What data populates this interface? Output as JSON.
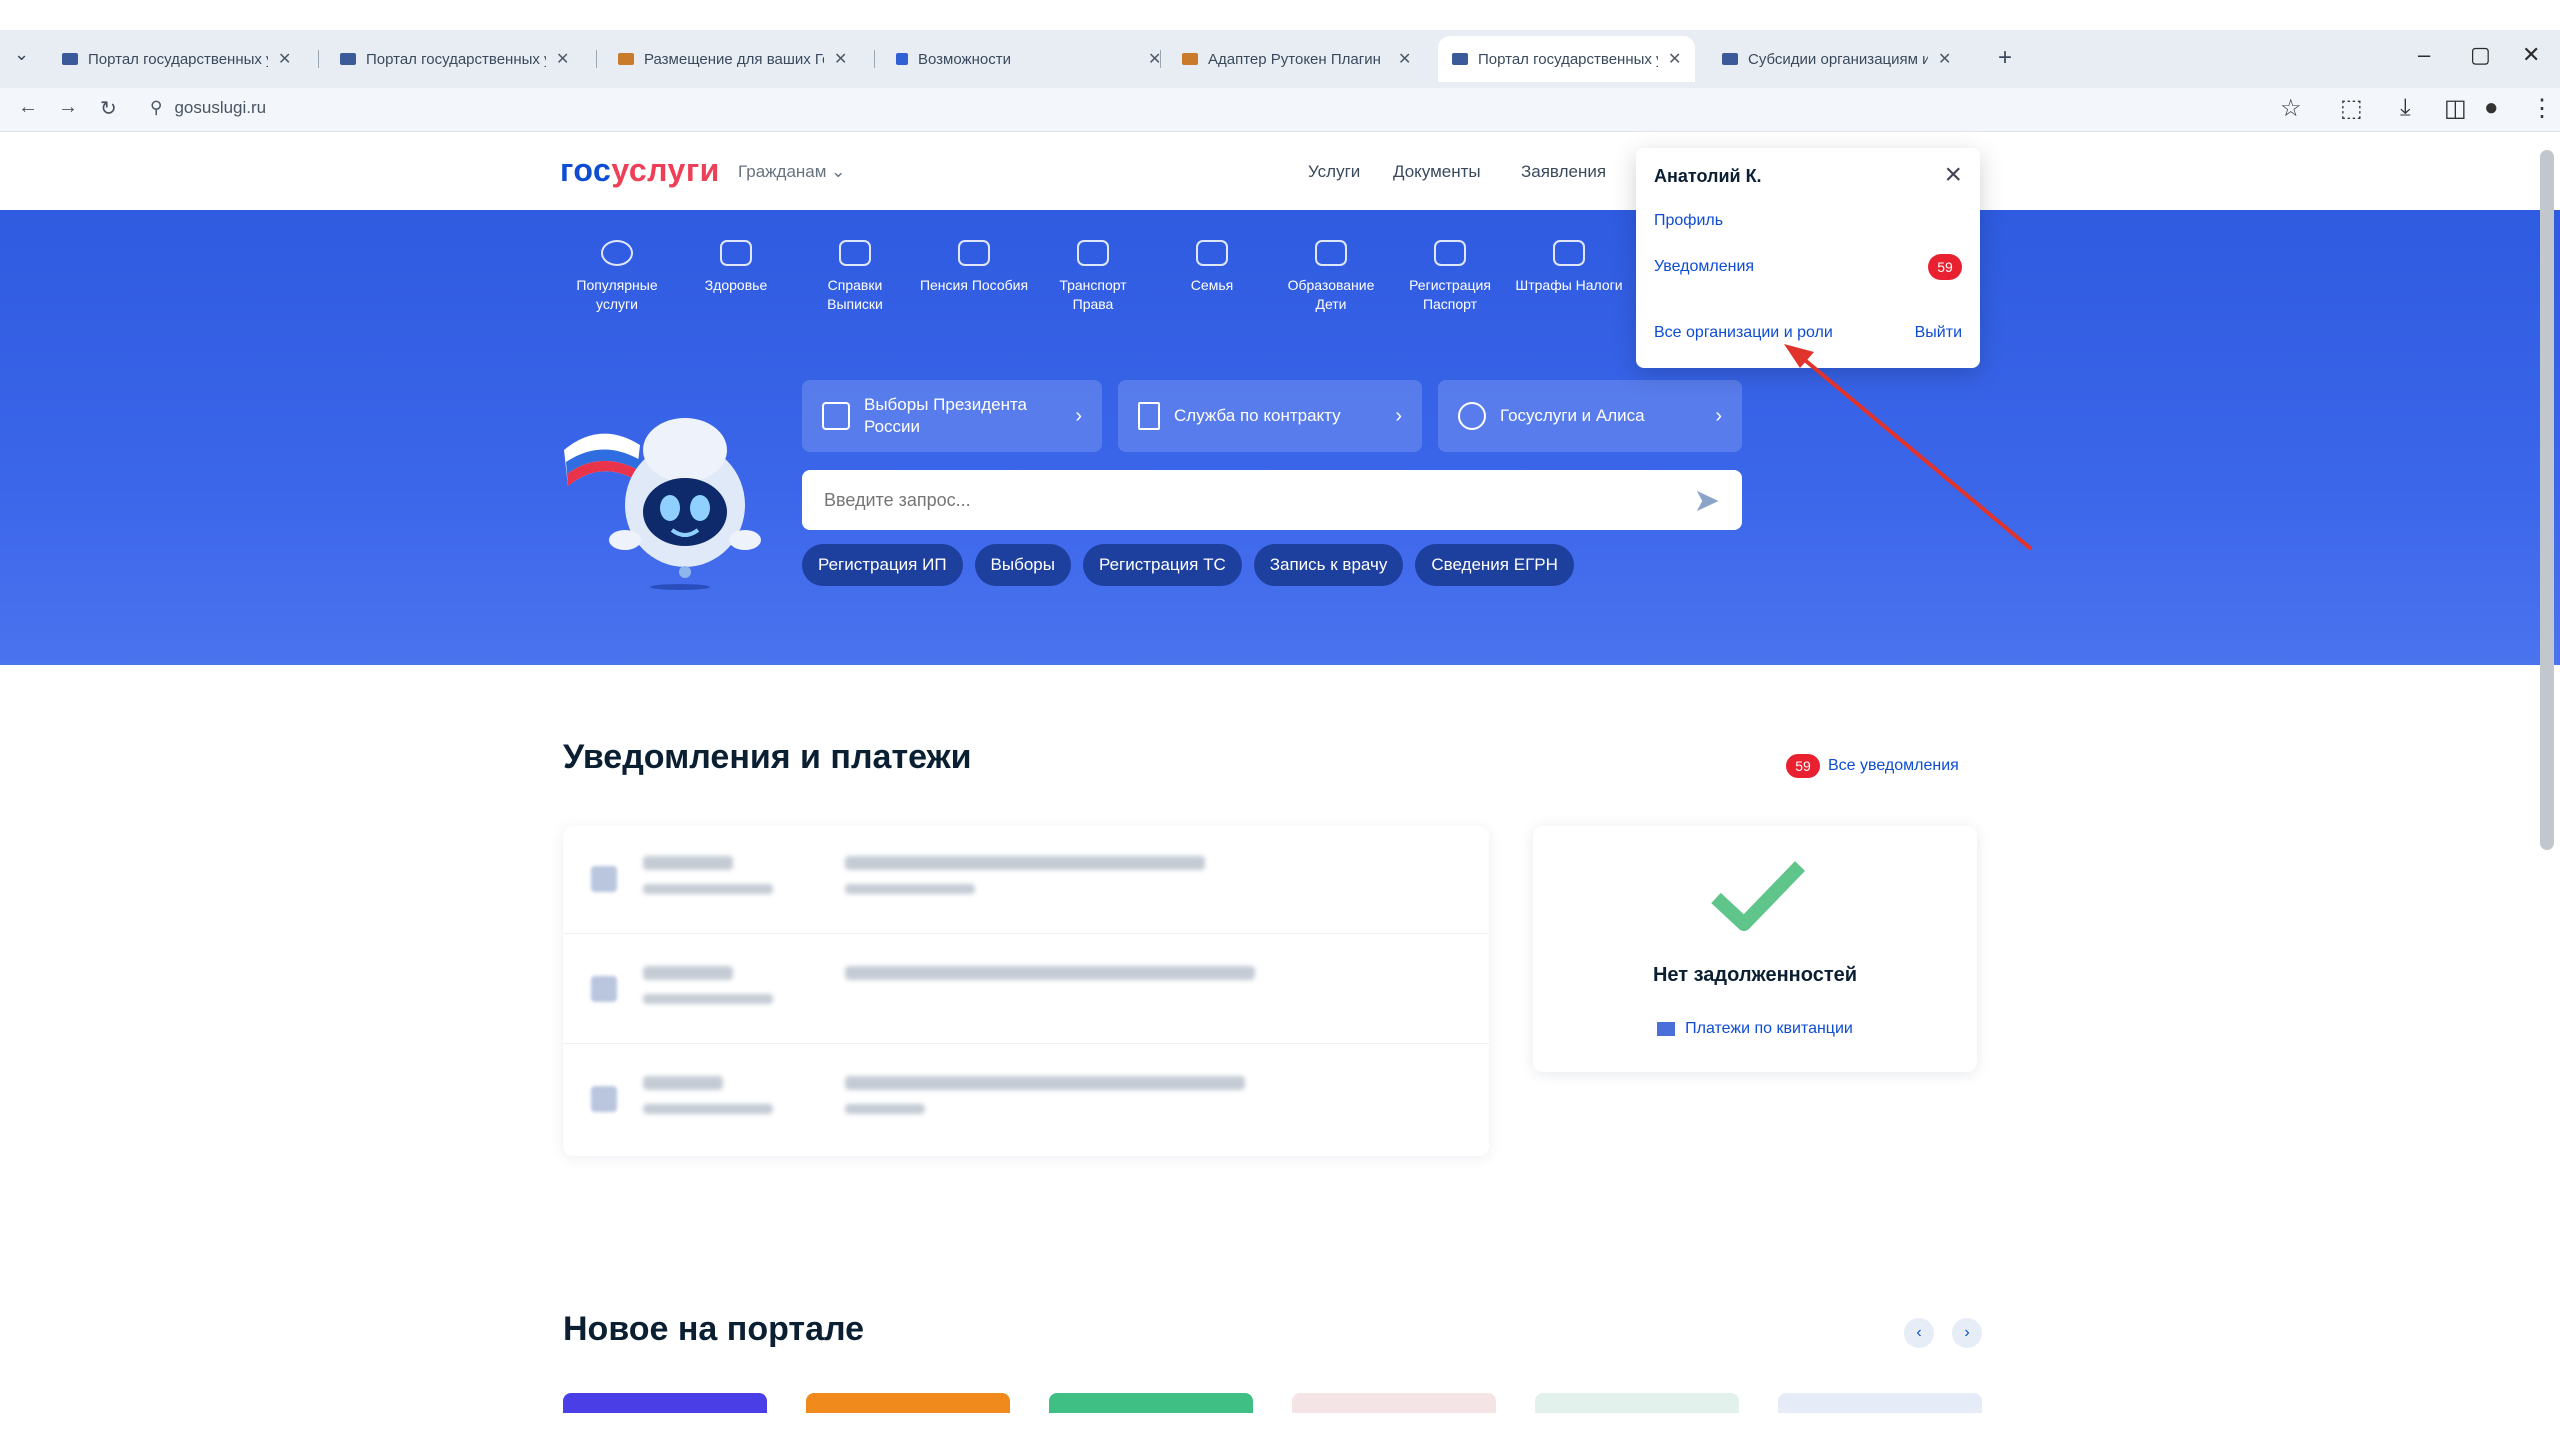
{
  "browser": {
    "tabs": [
      {
        "title": "Портал государственных усл"
      },
      {
        "title": "Портал государственных усл"
      },
      {
        "title": "Размещение для ваших Госу"
      },
      {
        "title": "Возможности"
      },
      {
        "title": "Адаптер Рутокен Плагин"
      },
      {
        "title": "Портал государственных усл"
      },
      {
        "title": "Субсидии организациям и г"
      }
    ],
    "url": "gosuslugi.ru"
  },
  "header": {
    "logo_part1": "гос",
    "logo_part2": "услуги",
    "role_selector": "Гражданам",
    "nav": [
      "Услуги",
      "Документы",
      "Заявления"
    ]
  },
  "categories": [
    {
      "label": "Популярные услуги"
    },
    {
      "label": "Здоровье"
    },
    {
      "label": "Справки Выписки"
    },
    {
      "label": "Пенсия Пособия"
    },
    {
      "label": "Транспорт Права"
    },
    {
      "label": "Семья"
    },
    {
      "label": "Образование Дети"
    },
    {
      "label": "Регистрация Паспорт"
    },
    {
      "label": "Штрафы Налоги"
    }
  ],
  "hero": {
    "promo_buttons": [
      {
        "label": "Выборы Президента России"
      },
      {
        "label": "Служба по контракту"
      },
      {
        "label": "Госуслуги и Алиса"
      }
    ],
    "search_placeholder": "Введите запрос...",
    "chips": [
      "Регистрация ИП",
      "Выборы",
      "Регистрация ТС",
      "Запись к врачу",
      "Сведения ЕГРН"
    ]
  },
  "user_menu": {
    "name": "Анатолий К.",
    "profile": "Профиль",
    "notifications": "Уведомления",
    "notifications_count": "59",
    "all_orgs": "Все организации и роли",
    "logout": "Выйти"
  },
  "notifications_section": {
    "title": "Уведомления и платежи",
    "all_link": "Все уведомления",
    "count": "59",
    "debt_title": "Нет задолженностей",
    "debt_link": "Платежи по квитанции"
  },
  "news_section": {
    "title": "Новое на портале"
  },
  "colors": {
    "brand_blue": "#0d4cd3",
    "brand_red": "#ee3f58",
    "hero_blue": "#3b66ea",
    "badge_red": "#e9202f",
    "check_green": "#5fc58a",
    "annotation_arrow": "#e0332c"
  }
}
